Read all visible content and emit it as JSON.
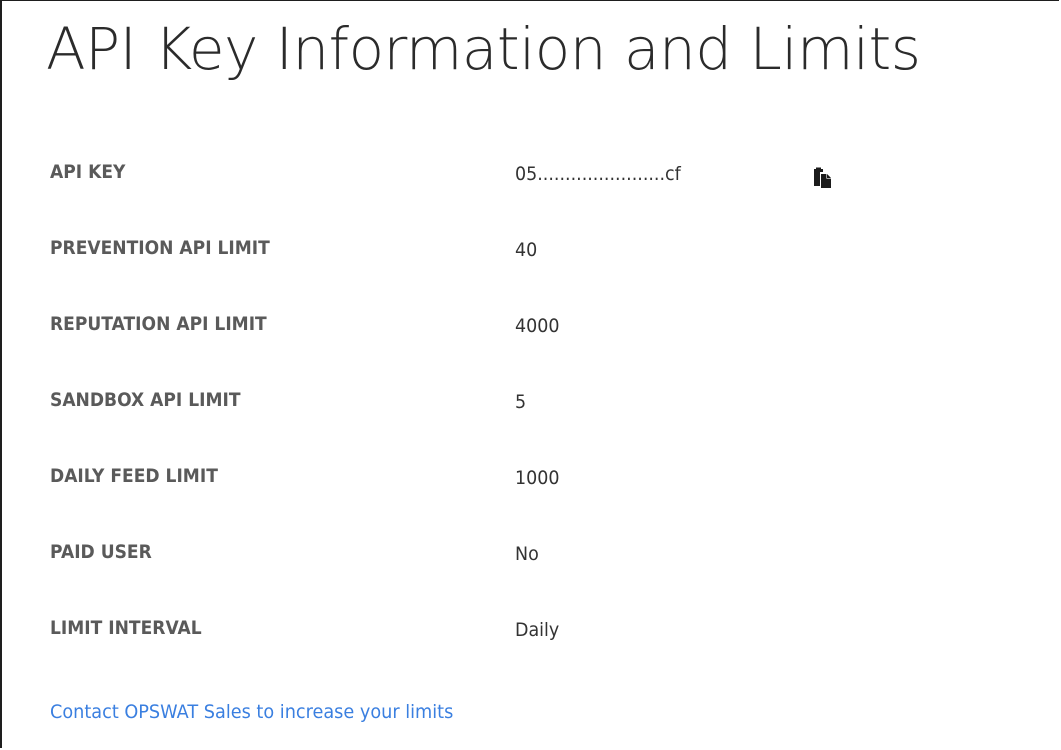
{
  "page": {
    "title": "API Key Information and Limits"
  },
  "rows": [
    {
      "label": "API KEY",
      "value": "05.......................cf"
    },
    {
      "label": "PREVENTION API LIMIT",
      "value": "40"
    },
    {
      "label": "REPUTATION API LIMIT",
      "value": "4000"
    },
    {
      "label": "SANDBOX API LIMIT",
      "value": "5"
    },
    {
      "label": "DAILY FEED LIMIT",
      "value": "1000"
    },
    {
      "label": "PAID USER",
      "value": "No"
    },
    {
      "label": "LIMIT INTERVAL",
      "value": "Daily"
    }
  ],
  "api_key": {
    "copy_icon": "copy-icon"
  },
  "footer": {
    "contact_link": "Contact OPSWAT Sales to increase your limits"
  },
  "colors": {
    "link": "#3a7fe0",
    "label": "#5a5a5a",
    "value": "#333333",
    "title": "#2b2b2b"
  }
}
